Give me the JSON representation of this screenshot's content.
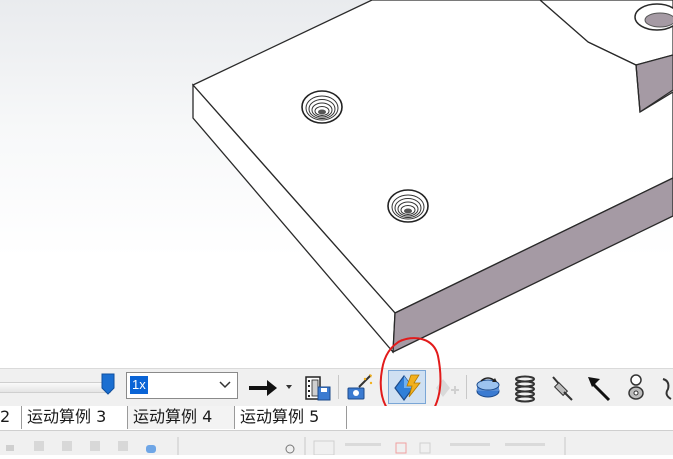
{
  "viewport": {
    "model": "part-plate-with-holes"
  },
  "toolbar": {
    "playback_speed": "1x",
    "icons": [
      "time-slider",
      "play-arrow-icon",
      "save-animation-icon",
      "animation-wizard-icon",
      "calculate-motion-study-icon",
      "add-key-icon",
      "motor-icon",
      "spring-icon",
      "damper-icon",
      "force-icon",
      "contact-icon"
    ]
  },
  "tabs": [
    {
      "label": "2"
    },
    {
      "label": "运动算例 3"
    },
    {
      "label": "运动算例 4"
    },
    {
      "label": "运动算例 5"
    }
  ],
  "annotation": {
    "color": "#e21b1b",
    "target": "calculate-motion-study-icon"
  },
  "colors": {
    "part_face": "#ffffff",
    "part_side": "#a59aa4",
    "part_edge": "#2a2a2a",
    "active_highlight": "#cfe0f2",
    "speed_selection": "#0a64d6"
  }
}
